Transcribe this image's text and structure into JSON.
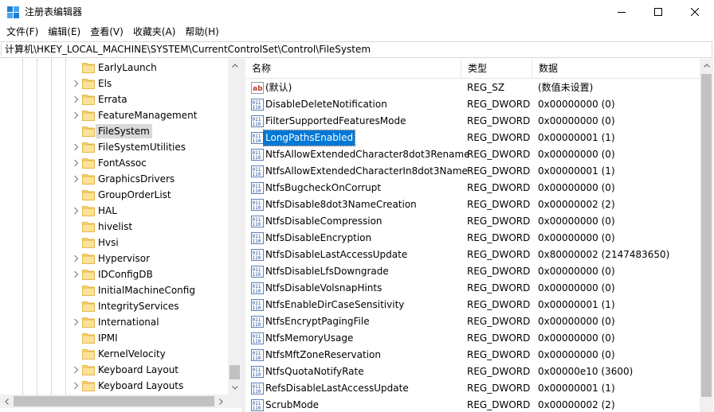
{
  "window": {
    "title": "注册表编辑器"
  },
  "menu": [
    "文件(F)",
    "编辑(E)",
    "查看(V)",
    "收藏夹(A)",
    "帮助(H)"
  ],
  "address": "计算机\\HKEY_LOCAL_MACHINE\\SYSTEM\\CurrentControlSet\\Control\\FileSystem",
  "tree": {
    "selected": "FileSystem",
    "items": [
      {
        "label": "EarlyLaunch",
        "expandable": false
      },
      {
        "label": "Els",
        "expandable": true
      },
      {
        "label": "Errata",
        "expandable": true
      },
      {
        "label": "FeatureManagement",
        "expandable": true
      },
      {
        "label": "FileSystem",
        "expandable": false
      },
      {
        "label": "FileSystemUtilities",
        "expandable": true
      },
      {
        "label": "FontAssoc",
        "expandable": true
      },
      {
        "label": "GraphicsDrivers",
        "expandable": true
      },
      {
        "label": "GroupOrderList",
        "expandable": false
      },
      {
        "label": "HAL",
        "expandable": true
      },
      {
        "label": "hivelist",
        "expandable": false
      },
      {
        "label": "Hvsi",
        "expandable": false
      },
      {
        "label": "Hypervisor",
        "expandable": true
      },
      {
        "label": "IDConfigDB",
        "expandable": true
      },
      {
        "label": "InitialMachineConfig",
        "expandable": false
      },
      {
        "label": "IntegrityServices",
        "expandable": false
      },
      {
        "label": "International",
        "expandable": true
      },
      {
        "label": "IPMI",
        "expandable": false
      },
      {
        "label": "KernelVelocity",
        "expandable": false
      },
      {
        "label": "Keyboard Layout",
        "expandable": true
      },
      {
        "label": "Keyboard Layouts",
        "expandable": true
      }
    ]
  },
  "list": {
    "columns": {
      "name": "名称",
      "type": "类型",
      "data": "数据"
    },
    "selected": "LongPathsEnabled",
    "rows": [
      {
        "name": "(默认)",
        "type": "REG_SZ",
        "data": "(数值未设置)",
        "icon": "string-value-icon"
      },
      {
        "name": "DisableDeleteNotification",
        "type": "REG_DWORD",
        "data": "0x00000000 (0)",
        "icon": "binary-value-icon"
      },
      {
        "name": "FilterSupportedFeaturesMode",
        "type": "REG_DWORD",
        "data": "0x00000000 (0)",
        "icon": "binary-value-icon"
      },
      {
        "name": "LongPathsEnabled",
        "type": "REG_DWORD",
        "data": "0x00000001 (1)",
        "icon": "binary-value-icon"
      },
      {
        "name": "NtfsAllowExtendedCharacter8dot3Rename",
        "type": "REG_DWORD",
        "data": "0x00000000 (0)",
        "icon": "binary-value-icon"
      },
      {
        "name": "NtfsAllowExtendedCharacterIn8dot3Name",
        "type": "REG_DWORD",
        "data": "0x00000001 (1)",
        "icon": "binary-value-icon"
      },
      {
        "name": "NtfsBugcheckOnCorrupt",
        "type": "REG_DWORD",
        "data": "0x00000000 (0)",
        "icon": "binary-value-icon"
      },
      {
        "name": "NtfsDisable8dot3NameCreation",
        "type": "REG_DWORD",
        "data": "0x00000002 (2)",
        "icon": "binary-value-icon"
      },
      {
        "name": "NtfsDisableCompression",
        "type": "REG_DWORD",
        "data": "0x00000000 (0)",
        "icon": "binary-value-icon"
      },
      {
        "name": "NtfsDisableEncryption",
        "type": "REG_DWORD",
        "data": "0x00000000 (0)",
        "icon": "binary-value-icon"
      },
      {
        "name": "NtfsDisableLastAccessUpdate",
        "type": "REG_DWORD",
        "data": "0x80000002 (2147483650)",
        "icon": "binary-value-icon"
      },
      {
        "name": "NtfsDisableLfsDowngrade",
        "type": "REG_DWORD",
        "data": "0x00000000 (0)",
        "icon": "binary-value-icon"
      },
      {
        "name": "NtfsDisableVolsnapHints",
        "type": "REG_DWORD",
        "data": "0x00000000 (0)",
        "icon": "binary-value-icon"
      },
      {
        "name": "NtfsEnableDirCaseSensitivity",
        "type": "REG_DWORD",
        "data": "0x00000001 (1)",
        "icon": "binary-value-icon"
      },
      {
        "name": "NtfsEncryptPagingFile",
        "type": "REG_DWORD",
        "data": "0x00000000 (0)",
        "icon": "binary-value-icon"
      },
      {
        "name": "NtfsMemoryUsage",
        "type": "REG_DWORD",
        "data": "0x00000000 (0)",
        "icon": "binary-value-icon"
      },
      {
        "name": "NtfsMftZoneReservation",
        "type": "REG_DWORD",
        "data": "0x00000000 (0)",
        "icon": "binary-value-icon"
      },
      {
        "name": "NtfsQuotaNotifyRate",
        "type": "REG_DWORD",
        "data": "0x00000e10 (3600)",
        "icon": "binary-value-icon"
      },
      {
        "name": "RefsDisableLastAccessUpdate",
        "type": "REG_DWORD",
        "data": "0x00000001 (1)",
        "icon": "binary-value-icon"
      },
      {
        "name": "ScrubMode",
        "type": "REG_DWORD",
        "data": "0x00000002 (2)",
        "icon": "binary-value-icon"
      }
    ]
  },
  "colors": {
    "selection": "#0078d7",
    "tree_selection": "#d9d9d9",
    "folder": "#f8d775",
    "folder_dark": "#e3b949"
  }
}
